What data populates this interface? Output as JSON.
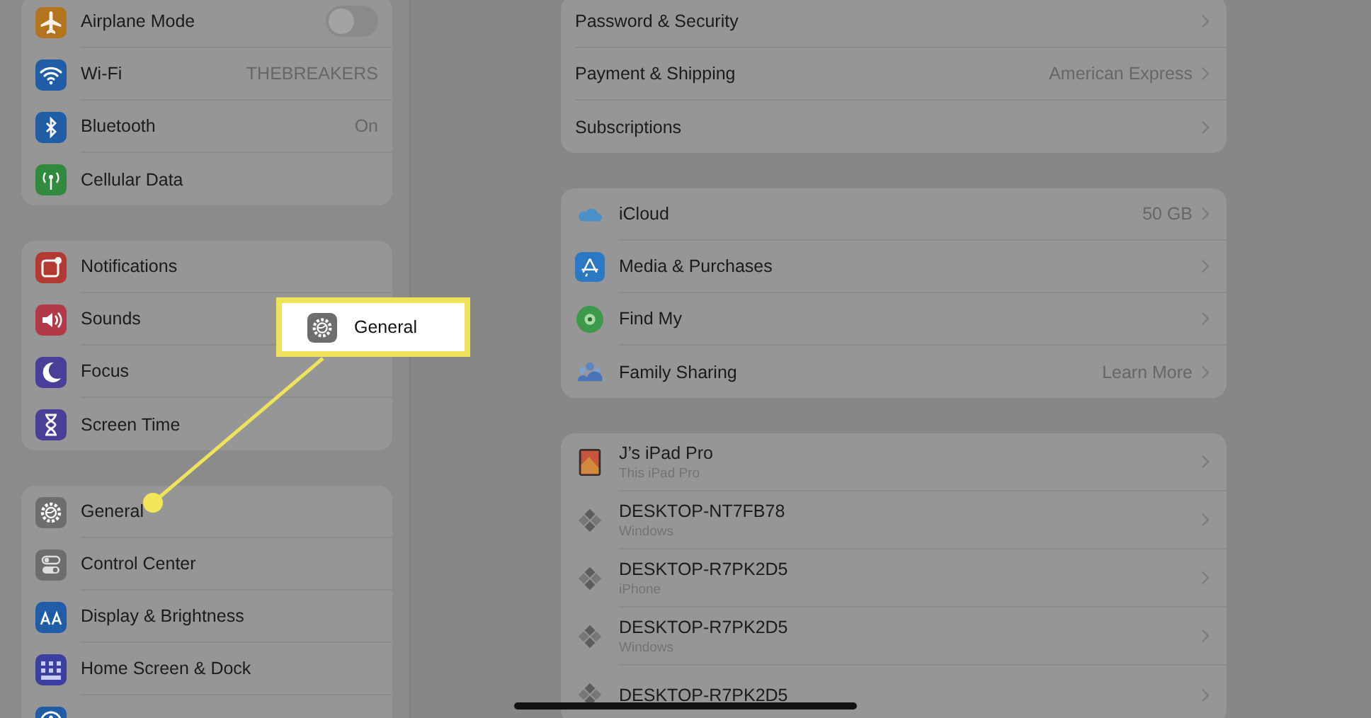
{
  "sidebar": {
    "groups": [
      {
        "items": [
          {
            "label": "Airplane Mode",
            "color": "#b4731e",
            "kind": "toggle",
            "on": false
          },
          {
            "label": "Wi-Fi",
            "color": "#1f5ea6",
            "kind": "value",
            "value": "THEBREAKERS"
          },
          {
            "label": "Bluetooth",
            "color": "#1f5ea6",
            "kind": "value",
            "value": "On"
          },
          {
            "label": "Cellular Data",
            "color": "#2f8a3e",
            "kind": "plain"
          }
        ]
      },
      {
        "items": [
          {
            "label": "Notifications",
            "color": "#b33a33",
            "kind": "plain"
          },
          {
            "label": "Sounds",
            "color": "#b23a48",
            "kind": "plain"
          },
          {
            "label": "Focus",
            "color": "#4a3f98",
            "kind": "plain"
          },
          {
            "label": "Screen Time",
            "color": "#4a3f98",
            "kind": "plain"
          }
        ]
      },
      {
        "items": [
          {
            "label": "General",
            "color": "#6d6d6d",
            "kind": "plain"
          },
          {
            "label": "Control Center",
            "color": "#6d6d6d",
            "kind": "plain"
          },
          {
            "label": "Display & Brightness",
            "color": "#1f5ea6",
            "kind": "plain"
          },
          {
            "label": "Home Screen & Dock",
            "color": "#3a3fa0",
            "kind": "plain"
          },
          {
            "color": "#1f5ea6",
            "kind": "plain"
          }
        ]
      }
    ]
  },
  "detail": {
    "groups": [
      {
        "items": [
          {
            "label": "Password & Security"
          },
          {
            "label": "Payment & Shipping",
            "value": "American Express"
          },
          {
            "label": "Subscriptions"
          }
        ]
      },
      {
        "items": [
          {
            "label": "iCloud",
            "value": "50 GB"
          },
          {
            "label": "Media & Purchases"
          },
          {
            "label": "Find My"
          },
          {
            "label": "Family Sharing",
            "value": "Learn More"
          }
        ]
      }
    ],
    "devices": [
      {
        "name": "J’s iPad Pro",
        "subtitle": "This iPad Pro",
        "kind": "tablet"
      },
      {
        "name": "DESKTOP-NT7FB78",
        "subtitle": "Windows",
        "kind": "computer"
      },
      {
        "name": "DESKTOP-R7PK2D5",
        "subtitle": "iPhone",
        "kind": "computer"
      },
      {
        "name": "DESKTOP-R7PK2D5",
        "subtitle": "Windows",
        "kind": "computer"
      },
      {
        "name": "DESKTOP-R7PK2D5",
        "kind": "computer"
      }
    ]
  },
  "callout": {
    "label": "General",
    "color": "#6d6d6d"
  }
}
